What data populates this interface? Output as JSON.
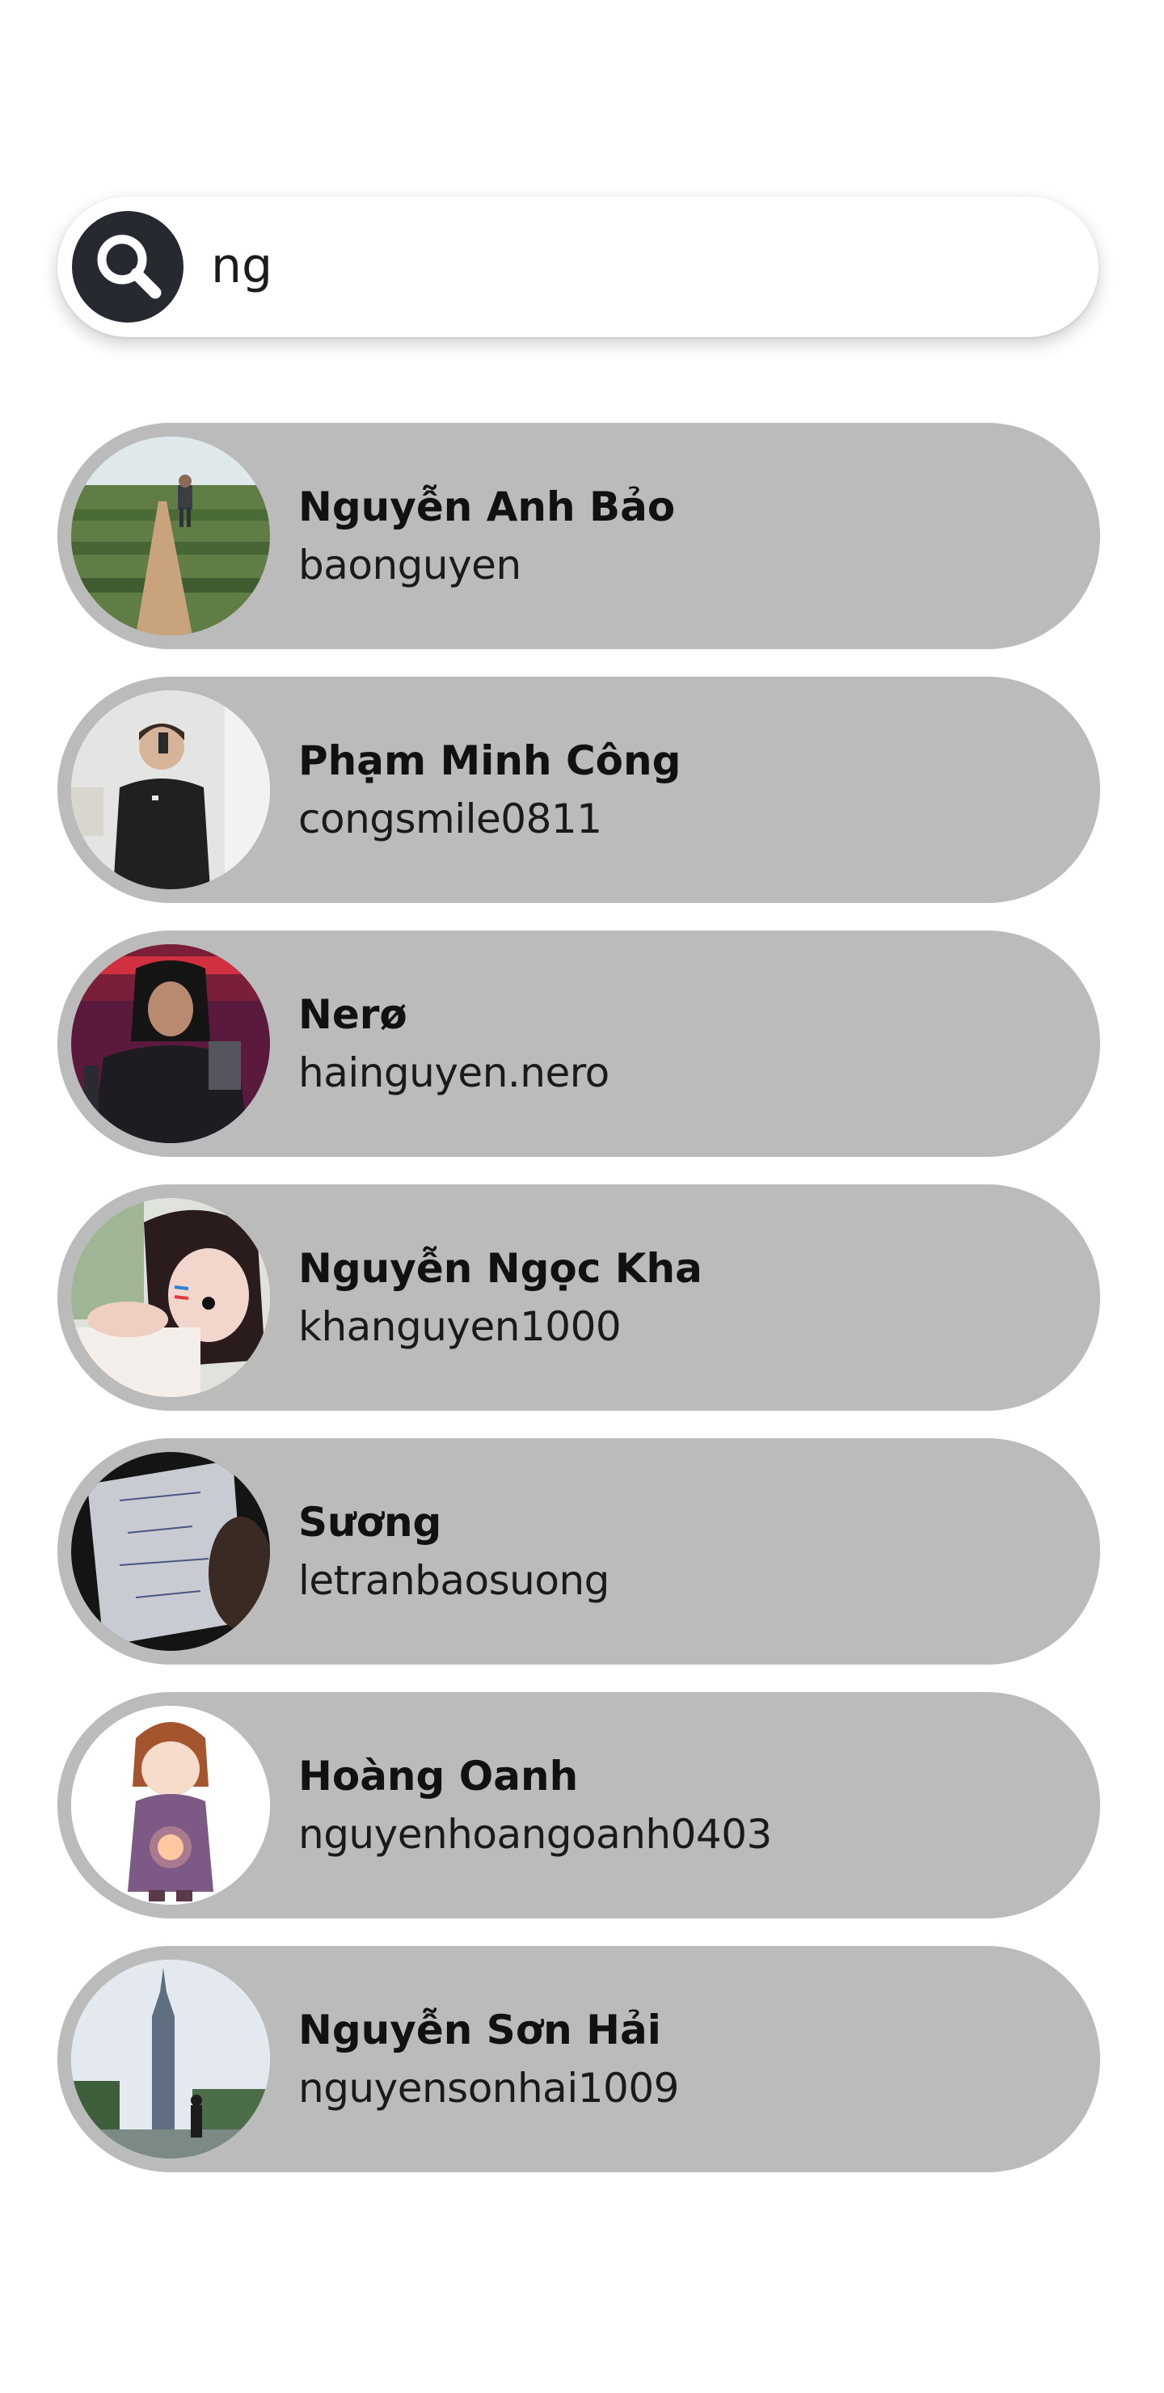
{
  "search": {
    "query": "ng",
    "icon": "search-icon"
  },
  "results": [
    {
      "name": "Nguyễn Anh Bảo",
      "username": "baonguyen"
    },
    {
      "name": "Phạm Minh Công",
      "username": "congsmile0811"
    },
    {
      "name": "Nerø",
      "username": "hainguyen.nero"
    },
    {
      "name": "Nguyễn Ngọc Kha",
      "username": "khanguyen1000"
    },
    {
      "name": "Sương",
      "username": "letranbaosuong"
    },
    {
      "name": "Hoàng Oanh",
      "username": "nguyenhoangoanh0403"
    },
    {
      "name": "Nguyễn Sơn Hải",
      "username": "nguyensonhai1009"
    }
  ],
  "colors": {
    "card_background": "#bbbbbb",
    "search_icon_background": "#262a30",
    "page_background": "#ffffff"
  }
}
